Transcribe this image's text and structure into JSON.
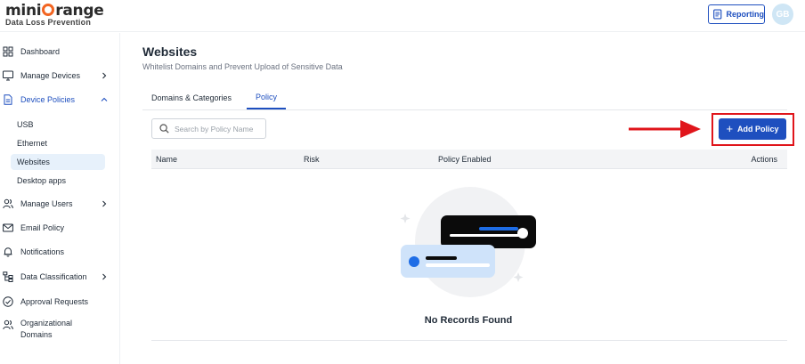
{
  "header": {
    "logo_prefix": "mini",
    "logo_suffix": "range",
    "logo_tagline": "Data Loss Prevention",
    "reporting_label": "Reporting",
    "avatar_initials": "GB"
  },
  "sidebar": {
    "items": [
      {
        "label": "Dashboard"
      },
      {
        "label": "Manage Devices"
      },
      {
        "label": "Device Policies"
      },
      {
        "label": "Manage Users"
      },
      {
        "label": "Email Policy"
      },
      {
        "label": "Notifications"
      },
      {
        "label": "Data Classification"
      },
      {
        "label": "Approval Requests"
      },
      {
        "label_line1": "Organizational",
        "label_line2": "Domains"
      }
    ],
    "sub_items": [
      {
        "label": "USB"
      },
      {
        "label": "Ethernet"
      },
      {
        "label": "Websites"
      },
      {
        "label": "Desktop apps"
      }
    ]
  },
  "main": {
    "title": "Websites",
    "subtitle": "Whitelist Domains and Prevent Upload of Sensitive Data",
    "tabs": [
      {
        "label": "Domains & Categories"
      },
      {
        "label": "Policy"
      }
    ],
    "search_placeholder": "Search by Policy Name",
    "add_button_label": "Add Policy",
    "table_headers": [
      "Name",
      "Risk",
      "Policy Enabled",
      "Actions"
    ],
    "empty_message": "No Records Found"
  },
  "colors": {
    "accent": "#1e4fbf",
    "brand_orange": "#f26522",
    "annotation_red": "#e0151b",
    "selected_bg": "#e7f1fb"
  }
}
